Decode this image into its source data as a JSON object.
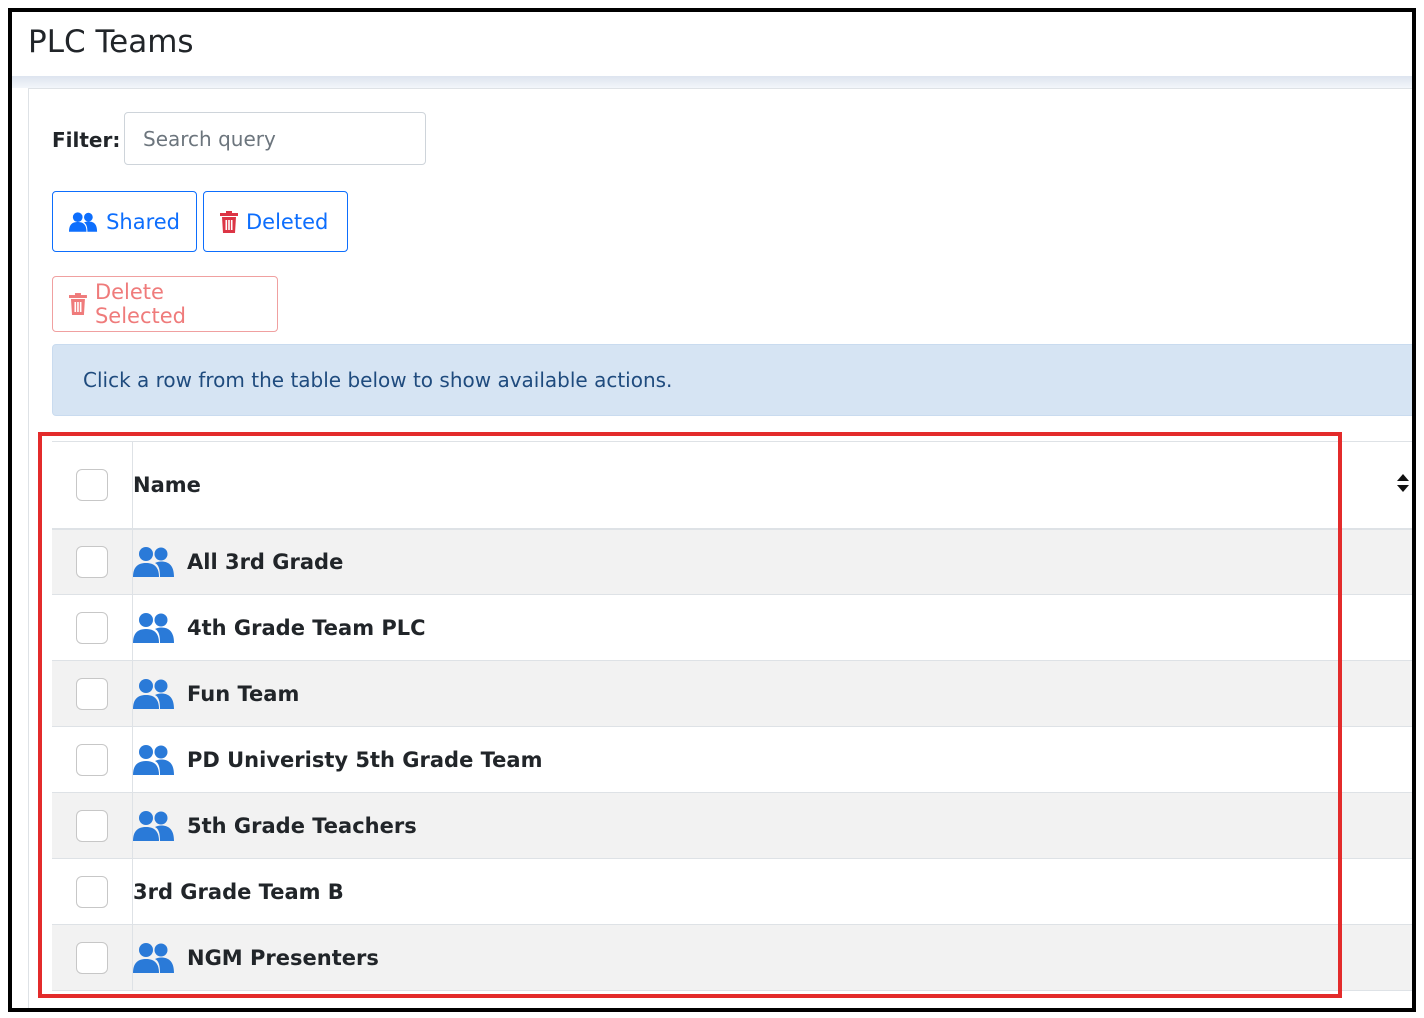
{
  "header": {
    "title": "PLC Teams"
  },
  "filter": {
    "label": "Filter:",
    "placeholder": "Search query",
    "value": ""
  },
  "buttons": {
    "shared": "Shared",
    "deleted": "Deleted",
    "delete_selected": "Delete Selected"
  },
  "alert": {
    "text": "Click a row from the table below to show available actions."
  },
  "table": {
    "columns": [
      "Name"
    ],
    "rows": [
      {
        "name": "All 3rd Grade",
        "icon": "users-icon"
      },
      {
        "name": "4th Grade Team PLC",
        "icon": "users-icon"
      },
      {
        "name": "Fun Team",
        "icon": "users-icon"
      },
      {
        "name": "PD Univeristy 5th Grade Team",
        "icon": "users-icon"
      },
      {
        "name": "5th Grade Teachers",
        "icon": "users-icon"
      },
      {
        "name": "3rd Grade Team B",
        "icon": ""
      },
      {
        "name": "NGM Presenters",
        "icon": "users-icon"
      }
    ]
  },
  "colors": {
    "primary": "#0d6efd",
    "danger": "#dc3545",
    "icon_blue": "#2a7ad8",
    "highlight": "#e32b2b",
    "alert_bg": "#d6e4f3"
  }
}
